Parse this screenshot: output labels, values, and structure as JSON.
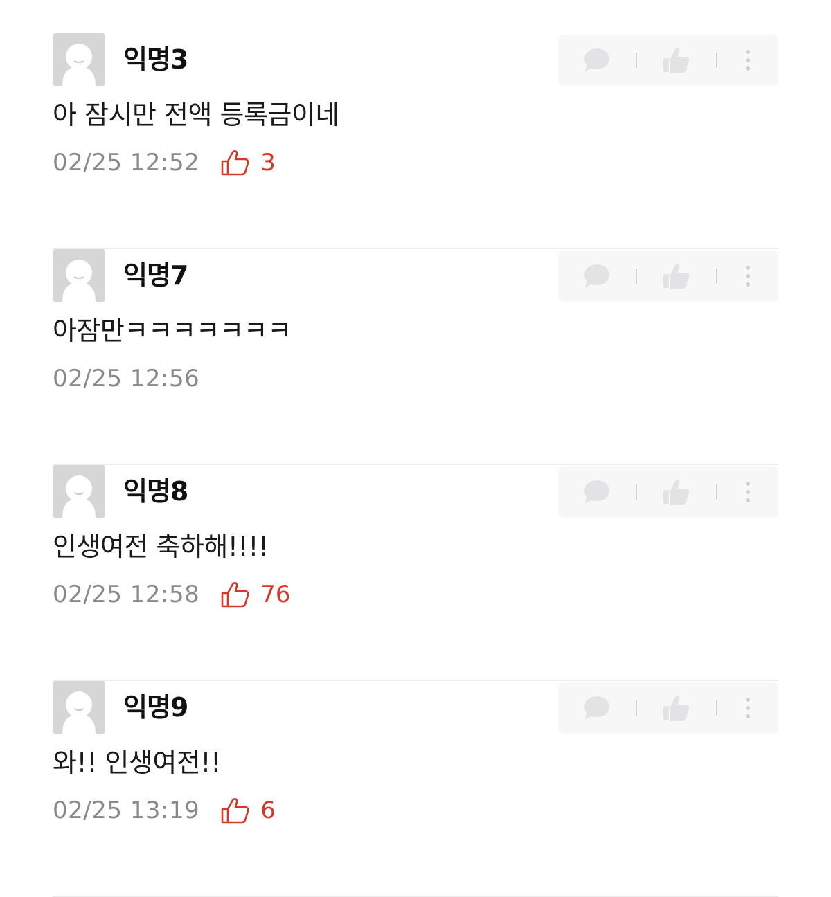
{
  "comments": [
    {
      "nickname": "익명3",
      "body": "아 잠시만 전액 등록금이네",
      "time": "02/25 12:52",
      "votes": "3"
    },
    {
      "nickname": "익명7",
      "body": "아잠만ㅋㅋㅋㅋㅋㅋㅋ",
      "time": "02/25 12:56",
      "votes": null
    },
    {
      "nickname": "익명8",
      "body": "인생여전 축하해!!!!",
      "time": "02/25 12:58",
      "votes": "76"
    },
    {
      "nickname": "익명9",
      "body": "와!! 인생여전!!",
      "time": "02/25 13:19",
      "votes": "6"
    }
  ],
  "icons": {
    "avatar": "default-avatar-icon",
    "reply": "speech-bubble-icon",
    "like": "thumbs-up-icon",
    "more": "more-vertical-icon",
    "vote": "thumbs-up-outline-icon"
  },
  "colors": {
    "vote": "#d23a28",
    "meta": "#8a8a8a",
    "action_bg": "#f7f7f7",
    "avatar_bg": "#d9d9dc"
  }
}
